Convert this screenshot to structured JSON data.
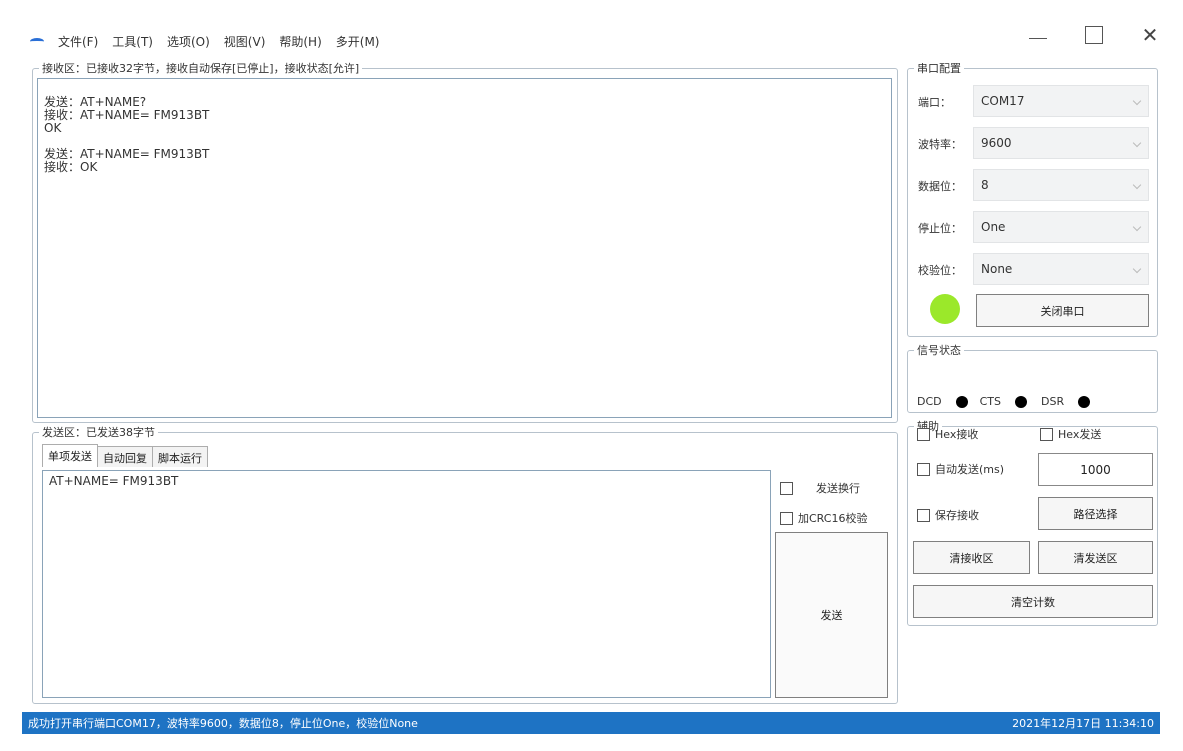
{
  "menu": [
    "文件(F)",
    "工具(T)",
    "选项(O)",
    "视图(V)",
    "帮助(H)",
    "多开(M)"
  ],
  "window_controls": {
    "close": "✕"
  },
  "receive": {
    "title": "接收区：已接收32字节，接收自动保存[已停止]，接收状态[允许]",
    "content": "\n发送：AT+NAME?\n接收：AT+NAME= FM913BT\nOK\n\n发送：AT+NAME= FM913BT\n接收：OK"
  },
  "send": {
    "title": "发送区：已发送38字节",
    "tabs": [
      "单项发送",
      "自动回复",
      "脚本运行"
    ],
    "content": "AT+NAME= FM913BT",
    "newline_label": "发送换行",
    "crc_label": "加CRC16校验",
    "send_button": "发送"
  },
  "serial": {
    "title": "串口配置",
    "port_label": "端口：",
    "port_value": "COM17",
    "baud_label": "波特率：",
    "baud_value": "9600",
    "data_label": "数据位：",
    "data_value": "8",
    "stop_label": "停止位：",
    "stop_value": "One",
    "parity_label": "校验位：",
    "parity_value": "None",
    "status_color": "#9be82a",
    "close_button": "关闭串口"
  },
  "signal": {
    "title": "信号状态",
    "dcd": "DCD",
    "cts": "CTS",
    "dsr": "DSR"
  },
  "aux": {
    "title": "辅助",
    "hex_recv": "Hex接收",
    "hex_send": "Hex发送",
    "auto_send": "自动发送(ms)",
    "auto_send_value": "1000",
    "save_recv": "保存接收",
    "path_button": "路径选择",
    "clear_recv_button": "清接收区",
    "clear_send_button": "清发送区",
    "clear_count_button": "清空计数"
  },
  "status": {
    "message": "成功打开串行端口COM17，波特率9600，数据位8，停止位One，校验位None",
    "datetime": "2021年12月17日 11:34:10"
  }
}
